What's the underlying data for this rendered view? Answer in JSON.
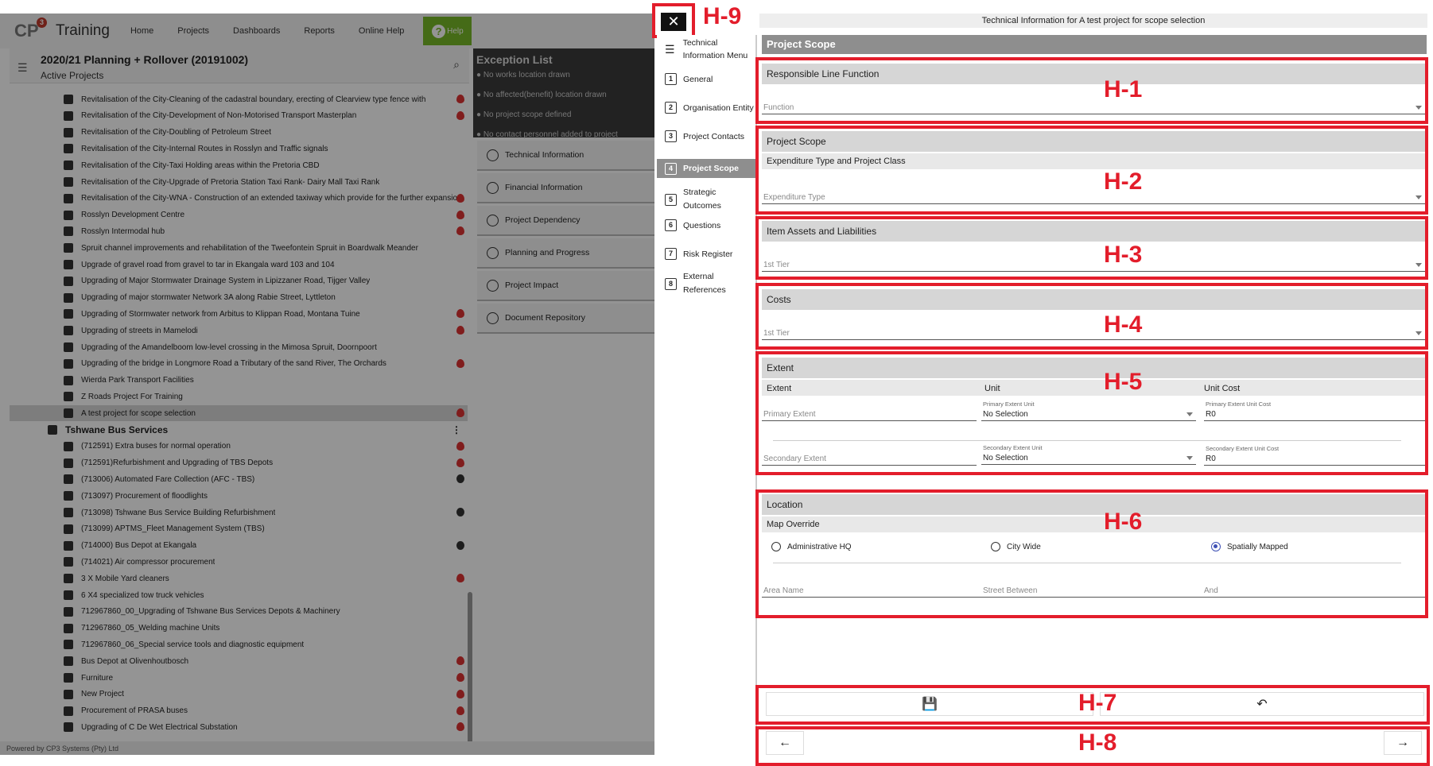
{
  "app": {
    "logo": "CP",
    "logo_sup": "3",
    "title": "Training",
    "nav": [
      "Home",
      "Projects",
      "Dashboards",
      "Reports",
      "Online Help"
    ],
    "help_label": "Help",
    "footer": "Powered by CP3 Systems (Pty) Ltd"
  },
  "project_header": {
    "title": "2020/21 Planning + Rollover (20191002)",
    "subtitle": "Active Projects"
  },
  "tree": {
    "items": [
      {
        "label": "Revitalisation of the City-Cleaning of the cadastral boundary, erecting of Clearview type fence with",
        "status": "fire"
      },
      {
        "label": "Revitalisation of the City-Development of Non-Motorised Transport Masterplan",
        "status": "fire"
      },
      {
        "label": "Revitalisation of the City-Doubling of Petroleum Street",
        "status": ""
      },
      {
        "label": "Revitalisation of the City-Internal Routes in Rosslyn and Traffic signals",
        "status": ""
      },
      {
        "label": "Revitalisation of the City-Taxi Holding areas within the Pretoria CBD",
        "status": ""
      },
      {
        "label": "Revitalisation of the City-Upgrade of Pretoria Station Taxi Rank- Dairy Mall Taxi Rank",
        "status": ""
      },
      {
        "label": "Revitalisation of the City-WNA - Construction of an extended taxiway which provide for the further expansion",
        "status": "fire"
      },
      {
        "label": "Rosslyn Development Centre",
        "status": "fire"
      },
      {
        "label": "Rosslyn Intermodal hub",
        "status": "fire"
      },
      {
        "label": "Spruit channel improvements and rehabilitation of the Tweefontein Spruit in Boardwalk Meander",
        "status": ""
      },
      {
        "label": "Upgrade of gravel road from gravel to tar in Ekangala ward 103 and 104",
        "status": ""
      },
      {
        "label": "Upgrading of Major Stormwater Drainage System in Lipizzaner Road, Tijger Valley",
        "status": ""
      },
      {
        "label": "Upgrading of major stormwater Network 3A along Rabie Street, Lyttleton",
        "status": ""
      },
      {
        "label": "Upgrading of Stormwater network from Arbitus to Klippan Road, Montana Tuine",
        "status": "fire"
      },
      {
        "label": "Upgrading of streets in Mamelodi",
        "status": "fire"
      },
      {
        "label": "Upgrading of the Amandelboom low-level crossing in the Mimosa Spruit, Doornpoort",
        "status": ""
      },
      {
        "label": "Upgrading of the bridge in Longmore Road a Tributary of the sand River, The Orchards",
        "status": "fire"
      },
      {
        "label": "Wierda Park Transport Facilities",
        "status": ""
      },
      {
        "label": "Z Roads Project For Training",
        "status": ""
      },
      {
        "label": "A test project for scope selection",
        "status": "fire"
      }
    ],
    "group_label": "Tshwane Bus Services",
    "group_items": [
      {
        "label": "(712591) Extra buses for normal operation",
        "status": "fire"
      },
      {
        "label": "(712591)Refurbishment and Upgrading of TBS Depots",
        "status": "fire"
      },
      {
        "label": "(713006) Automated Fare Collection (AFC - TBS)",
        "status": "ok"
      },
      {
        "label": "(713097) Procurement of floodlights",
        "status": ""
      },
      {
        "label": "(713098) Tshwane Bus Service Building Refurbishment",
        "status": "ok"
      },
      {
        "label": "(713099) APTMS_Fleet Management System (TBS)",
        "status": ""
      },
      {
        "label": "(714000) Bus Depot at Ekangala",
        "status": "ok"
      },
      {
        "label": "(714021) Air compressor procurement",
        "status": ""
      },
      {
        "label": "3 X Mobile Yard cleaners",
        "status": "fire"
      },
      {
        "label": "6 X4 specialized tow truck vehicles",
        "status": ""
      },
      {
        "label": "712967860_00_Upgrading of Tshwane Bus Services Depots & Machinery",
        "status": ""
      },
      {
        "label": "712967860_05_Welding machine Units",
        "status": ""
      },
      {
        "label": "712967860_06_Special service tools and diagnostic equipment",
        "status": ""
      },
      {
        "label": "Bus Depot at Olivenhoutbosch",
        "status": "fire"
      },
      {
        "label": "Furniture",
        "status": "fire"
      },
      {
        "label": "New Project",
        "status": "fire"
      },
      {
        "label": "Procurement of PRASA buses",
        "status": "fire"
      },
      {
        "label": "Upgrading of C De Wet Electrical Substation",
        "status": "fire"
      }
    ]
  },
  "exceptions": {
    "title": "Exception List",
    "items": [
      "No works location drawn",
      "No affected(benefit) location drawn",
      "No project scope defined",
      "No contact personnel added to project"
    ]
  },
  "side_menu": [
    "Technical Information",
    "Financial Information",
    "Project Dependency",
    "Planning and Progress",
    "Project Impact",
    "Document Repository"
  ],
  "dialog": {
    "header": "Technical Information for A test project for scope selection",
    "close": "✕",
    "menu_title_1": "Technical",
    "menu_title_2": "Information Menu",
    "menu": [
      {
        "num": "1",
        "label": "General"
      },
      {
        "num": "2",
        "label": "Organisation Entity"
      },
      {
        "num": "3",
        "label": "Project Contacts"
      },
      {
        "num": "4",
        "label": "Project Scope"
      },
      {
        "num": "5",
        "label": "Strategic Outcomes"
      },
      {
        "num": "6",
        "label": "Questions"
      },
      {
        "num": "7",
        "label": "Risk Register"
      },
      {
        "num": "8",
        "label": "External References"
      }
    ]
  },
  "scope": {
    "title": "Project Scope",
    "responsible": {
      "head": "Responsible Line Function",
      "field": "Function"
    },
    "project_scope": {
      "head": "Project Scope",
      "sub": "Expenditure Type and Project Class",
      "field": "Expenditure Type"
    },
    "assets": {
      "head": "Item Assets and Liabilities",
      "field": "1st Tier"
    },
    "costs": {
      "head": "Costs",
      "field": "1st Tier"
    },
    "extent": {
      "head": "Extent",
      "col1": "Extent",
      "col2": "Unit",
      "col3": "Unit Cost",
      "primary_extent": "Primary Extent",
      "primary_unit_label": "Primary Extent Unit",
      "primary_unit_value": "No Selection",
      "primary_cost_label": "Primary Extent Unit Cost",
      "primary_cost_value": "R0",
      "secondary_extent": "Secondary Extent",
      "secondary_unit_label": "Secondary Extent Unit",
      "secondary_unit_value": "No Selection",
      "secondary_cost_label": "Secondary Extent Unit Cost",
      "secondary_cost_value": "R0"
    },
    "location": {
      "head": "Location",
      "sub": "Map Override",
      "radio1": "Administrative HQ",
      "radio2": "City Wide",
      "radio3": "Spatially Mapped",
      "selected": "Spatially Mapped",
      "area": "Area Name",
      "street": "Street Between",
      "and": "And"
    }
  },
  "labels": {
    "h1": "H-1",
    "h2": "H-2",
    "h3": "H-3",
    "h4": "H-4",
    "h5": "H-5",
    "h6": "H-6",
    "h7": "H-7",
    "h8": "H-8",
    "h9": "H-9"
  },
  "actions": {
    "save": "💾",
    "undo": "↶",
    "back": "←",
    "forward": "→"
  }
}
